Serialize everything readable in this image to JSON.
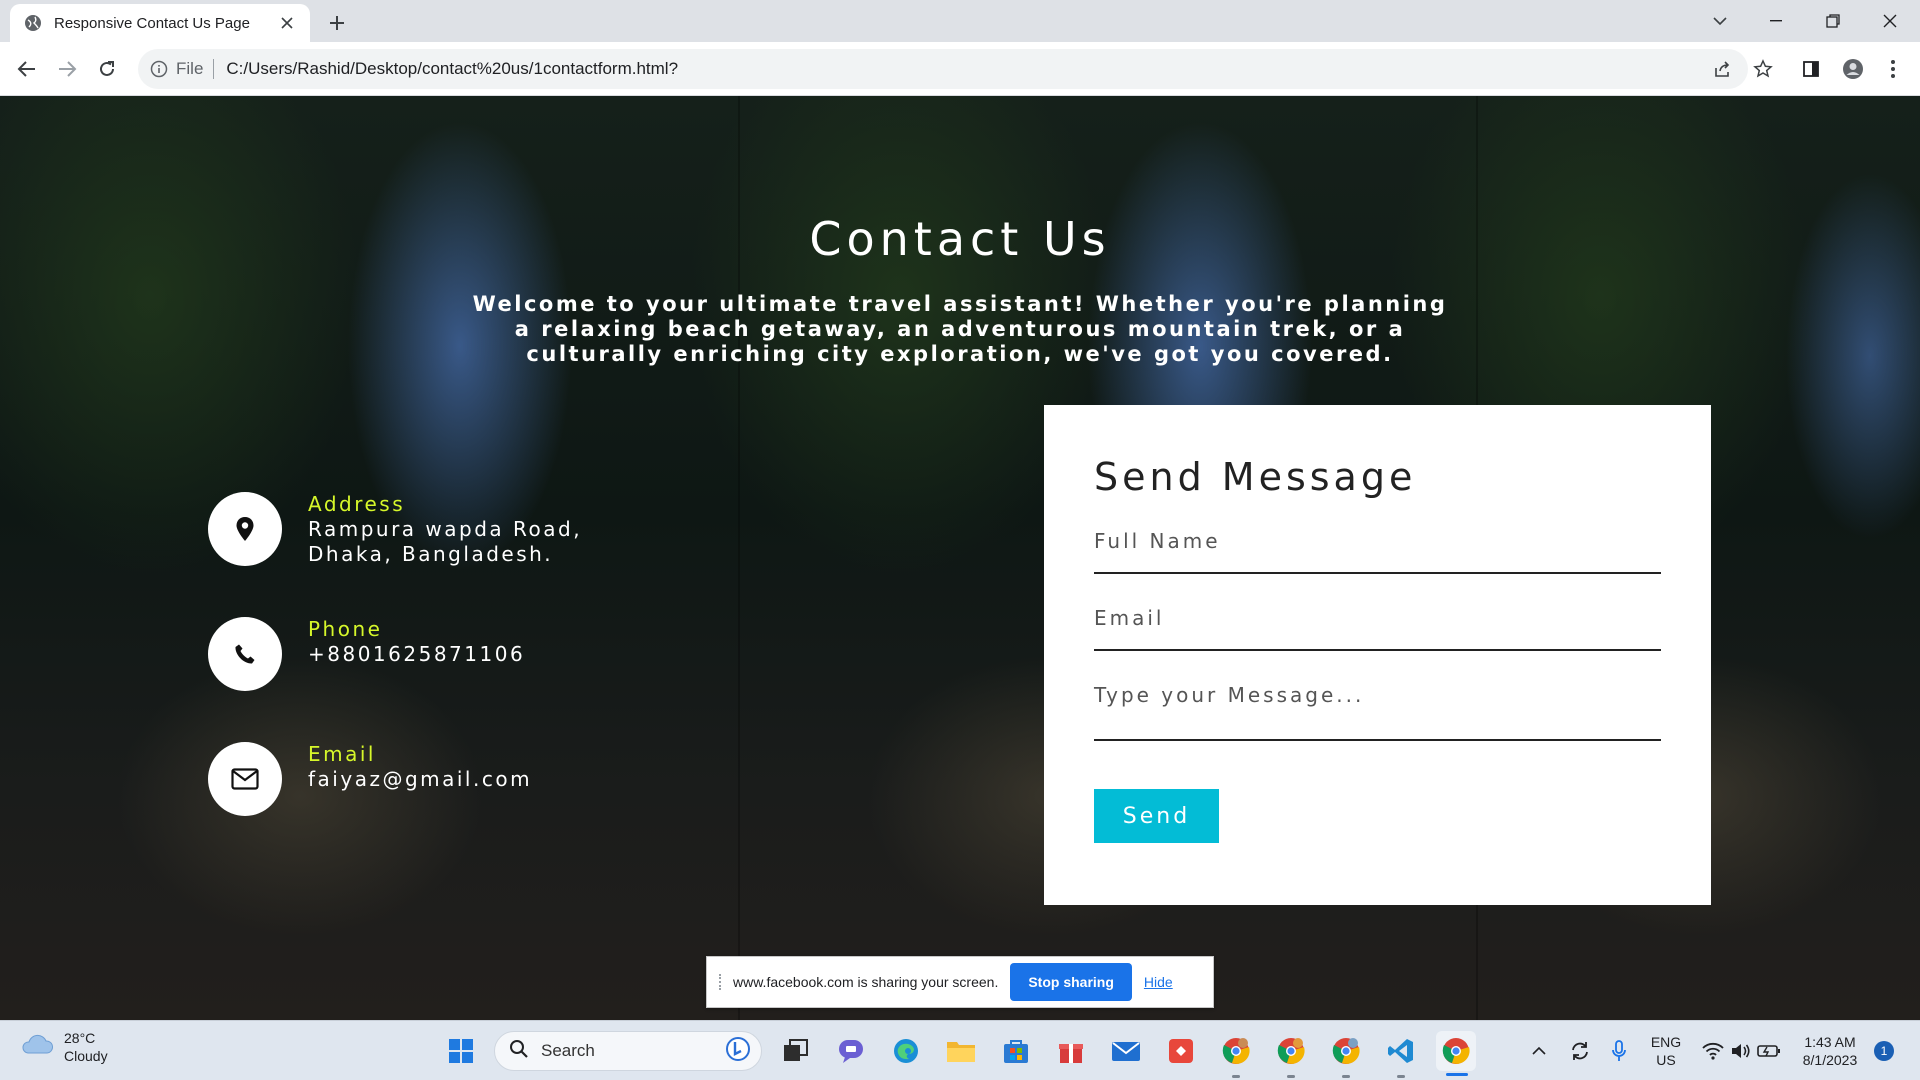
{
  "browser": {
    "tab_title": "Responsive Contact Us Page",
    "url_scheme": "File",
    "url": "C:/Users/Rashid/Desktop/contact%20us/1contactform.html?"
  },
  "page": {
    "title": "Contact Us",
    "intro": "Welcome to your ultimate travel assistant! Whether you're planning a relaxing beach getaway, an adventurous mountain trek, or a culturally enriching city exploration, we've got you covered.",
    "contact": {
      "address_label": "Address",
      "address_value": "Rampura wapda Road, Dhaka, Bangladesh.",
      "phone_label": "Phone",
      "phone_value": "+8801625871106",
      "email_label": "Email",
      "email_value": "faiyaz@gmail.com"
    },
    "form": {
      "title": "Send Message",
      "name_placeholder": "Full Name",
      "email_placeholder": "Email",
      "message_placeholder": "Type your Message...",
      "send_label": "Send"
    },
    "accent_color": "#d6f72a",
    "button_color": "#03bcd6"
  },
  "share_bar": {
    "text": "www.facebook.com is sharing your screen.",
    "stop_label": "Stop sharing",
    "hide_label": "Hide"
  },
  "taskbar": {
    "weather_temp": "28°C",
    "weather_desc": "Cloudy",
    "search_label": "Search",
    "lang_top": "ENG",
    "lang_bottom": "US",
    "time": "1:43 AM",
    "date": "8/1/2023",
    "notification_count": "1"
  }
}
